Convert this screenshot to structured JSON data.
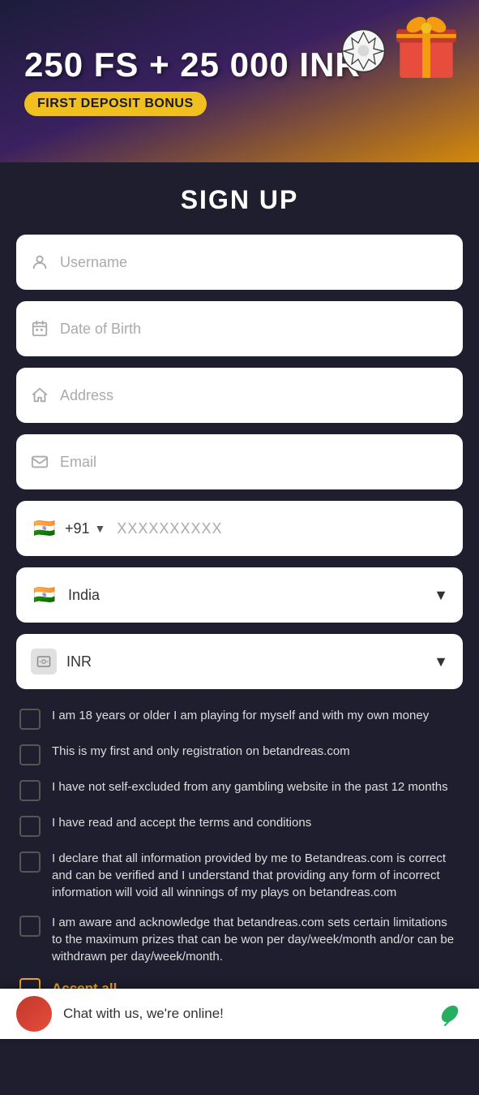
{
  "banner": {
    "title": "250 FS + 25 000 INR",
    "subtitle": "FIRST DEPOSIT BONUS"
  },
  "signup": {
    "title": "SIGN UP"
  },
  "form": {
    "username": {
      "placeholder": "Username"
    },
    "dob": {
      "placeholder": "Date of Birth"
    },
    "address": {
      "placeholder": "Address"
    },
    "email": {
      "placeholder": "Email"
    },
    "phone": {
      "code": "+91",
      "placeholder": "XXXXXXXXXX",
      "flag": "🇮🇳"
    },
    "country": {
      "value": "India",
      "flag": "🇮🇳"
    },
    "currency": {
      "value": "INR"
    }
  },
  "checkboxes": [
    {
      "id": "cb1",
      "label": "I am 18 years or older I am playing for myself and with my own money"
    },
    {
      "id": "cb2",
      "label": "This is my first and only registration on betandreas.com"
    },
    {
      "id": "cb3",
      "label": "I have not self-excluded from any gambling website in the past 12 months"
    },
    {
      "id": "cb4",
      "label": "I have read and accept the terms and conditions"
    },
    {
      "id": "cb5",
      "label": "I declare that all information provided by me to Betandreas.com is correct and can be verified and I understand that providing any form of incorrect information will void all winnings of my plays on betandreas.com"
    },
    {
      "id": "cb6",
      "label": "I am aware and acknowledge that betandreas.com sets certain limitations to the maximum prizes that can be won per day/week/month and/or can be withdrawn per day/week/month."
    }
  ],
  "acceptAll": {
    "label": "Accept all."
  },
  "chat": {
    "text": "Chat with us, we're online!"
  }
}
